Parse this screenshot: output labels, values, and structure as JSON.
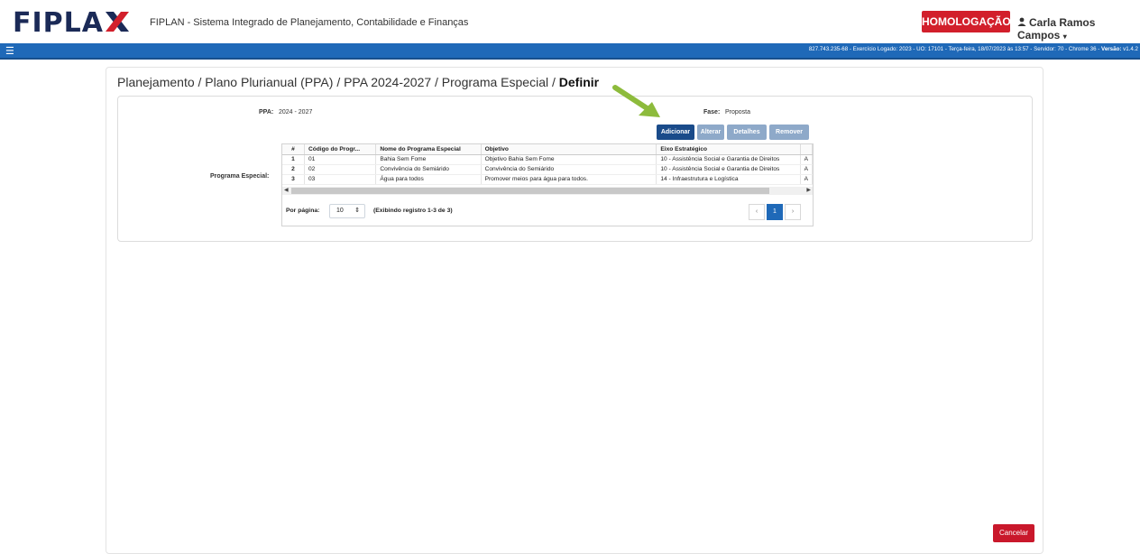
{
  "header": {
    "logo_text": "FIPLA",
    "app_title": "FIPLAN - Sistema Integrado de Planejamento, Contabilidade e Finanças",
    "environment_badge": "HOMOLOGAÇÃO",
    "user_name": "Carla Ramos Campos"
  },
  "statusbar": {
    "info": "827.743.235-68 - Exercício Logado: 2023 - UO: 17101 - Terça-feira, 18/07/2023 às 13:57 - Servidor: 70 - Chrome 36 - ",
    "version_label": "Versão:",
    "version_value": "v1.4.2"
  },
  "breadcrumb": {
    "path": "Planejamento / Plano Plurianual (PPA) / PPA 2024-2027 / Programa Especial / ",
    "current": "Definir"
  },
  "form": {
    "ppa_label": "PPA:",
    "ppa_value": "2024 - 2027",
    "fase_label": "Fase:",
    "fase_value": "Proposta",
    "programa_label": "Programa Especial:"
  },
  "toolbar": {
    "add": "Adicionar",
    "edit": "Alterar",
    "details": "Detalhes",
    "remove": "Remover"
  },
  "table": {
    "columns": [
      "#",
      "Código do Progr...",
      "Nome do Programa Especial",
      "Objetivo",
      "Eixo Estratégico",
      ""
    ],
    "rows": [
      {
        "n": "1",
        "code": "01",
        "name": "Bahia Sem Fome",
        "objective": "Objetivo Bahia Sem Fome",
        "axis": "10 - Assistência Social e Garantia de Direitos",
        "extra": "A"
      },
      {
        "n": "2",
        "code": "02",
        "name": "Convivência do Semiárido",
        "objective": "Convivência do Semiárido",
        "axis": "10 - Assistência Social e Garantia de Direitos",
        "extra": "A"
      },
      {
        "n": "3",
        "code": "03",
        "name": "Água para todos",
        "objective": "Promover meios para água para todos.",
        "axis": "14 - Infraestrutura e Logística",
        "extra": "A"
      }
    ]
  },
  "pager": {
    "per_page_label": "Por página:",
    "per_page_value": "10",
    "showing": "(Exibindo registro 1-3 de 3)",
    "prev": "‹",
    "current_page": "1",
    "next": "›"
  },
  "actions": {
    "cancel": "Cancelar"
  },
  "colors": {
    "brand_blue": "#1f69b8",
    "primary_button": "#1a4b8a",
    "danger": "#d21f2b",
    "arrow_green": "#8dbb3c"
  }
}
